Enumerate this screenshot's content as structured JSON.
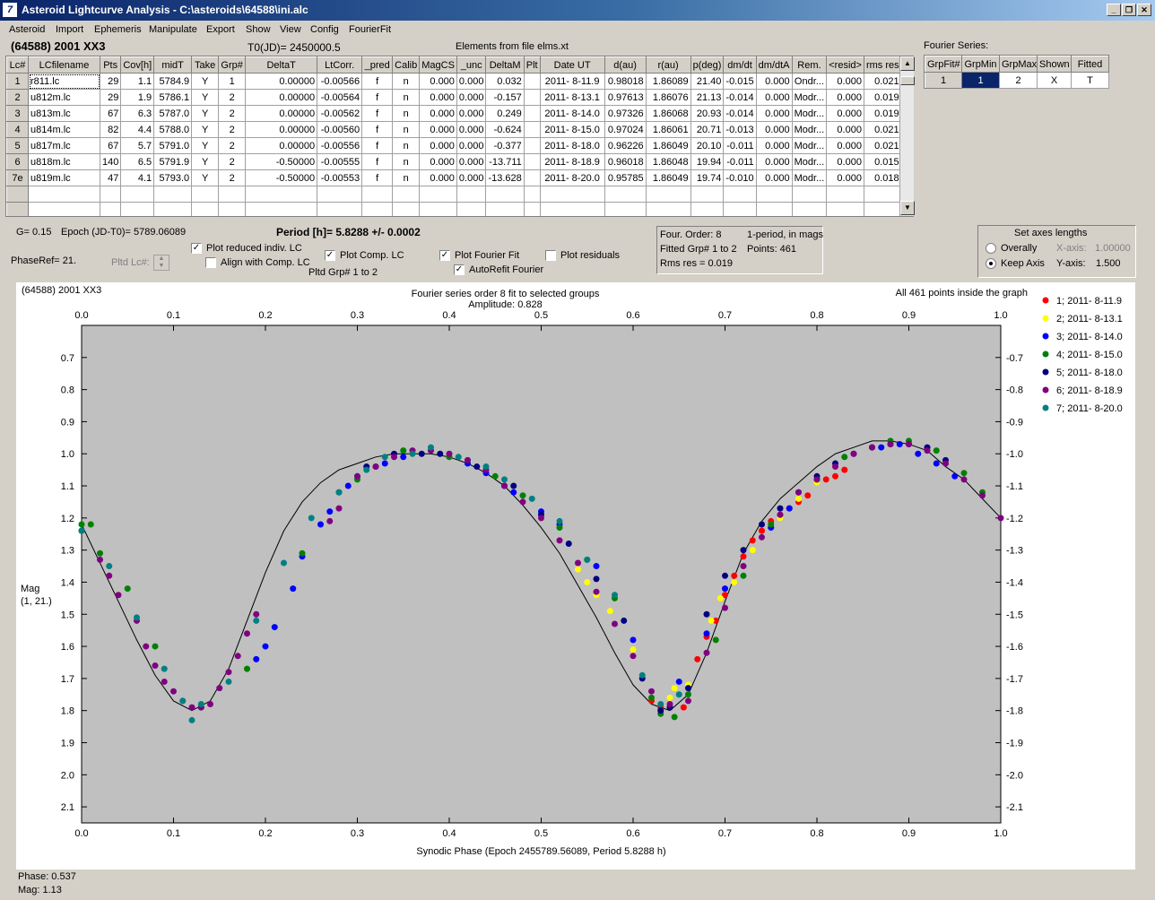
{
  "window": {
    "title": "Asteroid Lightcurve Analysis - C:\\asteroids\\64588\\ini.alc",
    "icon_glyph": "7",
    "minimize": "_",
    "restore": "❐",
    "close": "✕"
  },
  "menu": [
    "Asteroid",
    "Import",
    "Ephemeris",
    "Manipulate",
    "Export",
    "Show",
    "View",
    "Config",
    "FourierFit"
  ],
  "header": {
    "object": "(64588) 2001 XX3",
    "t0": "T0(JD)= 2450000.5",
    "elements": "Elements from file elms.xt"
  },
  "lc_table": {
    "columns": [
      "Lc#",
      "LCfilename",
      "Pts",
      "Cov[h]",
      "midT",
      "Take",
      "Grp#",
      "DeltaT",
      "LtCorr.",
      "_pred",
      "Calib",
      "MagCS",
      "_unc",
      "DeltaM",
      "Plt",
      "Date UT",
      "d(au)",
      "r(au)",
      "p(deg)",
      "dm/dt",
      "dm/dtA",
      "Rem.",
      "<resid>",
      "rms res"
    ],
    "rows": [
      [
        "1",
        "r811.lc",
        "29",
        "1.1",
        "5784.9",
        "Y",
        "1",
        "0.00000",
        "-0.00566",
        "f",
        "n",
        "0.000",
        "0.000",
        "0.032",
        "",
        "2011- 8-11.9",
        "0.98018",
        "1.86089",
        "21.40",
        "-0.015",
        "0.000",
        "Ondr...",
        "0.000",
        "0.021"
      ],
      [
        "2",
        "u812m.lc",
        "29",
        "1.9",
        "5786.1",
        "Y",
        "2",
        "0.00000",
        "-0.00564",
        "f",
        "n",
        "0.000",
        "0.000",
        "-0.157",
        "",
        "2011- 8-13.1",
        "0.97613",
        "1.86076",
        "21.13",
        "-0.014",
        "0.000",
        "Modr...",
        "0.000",
        "0.019"
      ],
      [
        "3",
        "u813m.lc",
        "67",
        "6.3",
        "5787.0",
        "Y",
        "2",
        "0.00000",
        "-0.00562",
        "f",
        "n",
        "0.000",
        "0.000",
        "0.249",
        "",
        "2011- 8-14.0",
        "0.97326",
        "1.86068",
        "20.93",
        "-0.014",
        "0.000",
        "Modr...",
        "0.000",
        "0.019"
      ],
      [
        "4",
        "u814m.lc",
        "82",
        "4.4",
        "5788.0",
        "Y",
        "2",
        "0.00000",
        "-0.00560",
        "f",
        "n",
        "0.000",
        "0.000",
        "-0.624",
        "",
        "2011- 8-15.0",
        "0.97024",
        "1.86061",
        "20.71",
        "-0.013",
        "0.000",
        "Modr...",
        "0.000",
        "0.021"
      ],
      [
        "5",
        "u817m.lc",
        "67",
        "5.7",
        "5791.0",
        "Y",
        "2",
        "0.00000",
        "-0.00556",
        "f",
        "n",
        "0.000",
        "0.000",
        "-0.377",
        "",
        "2011- 8-18.0",
        "0.96226",
        "1.86049",
        "20.10",
        "-0.011",
        "0.000",
        "Modr...",
        "0.000",
        "0.021"
      ],
      [
        "6",
        "u818m.lc",
        "140",
        "6.5",
        "5791.9",
        "Y",
        "2",
        "-0.50000",
        "-0.00555",
        "f",
        "n",
        "0.000",
        "0.000",
        "-13.711",
        "",
        "2011- 8-18.9",
        "0.96018",
        "1.86048",
        "19.94",
        "-0.011",
        "0.000",
        "Modr...",
        "0.000",
        "0.015"
      ],
      [
        "7e",
        "u819m.lc",
        "47",
        "4.1",
        "5793.0",
        "Y",
        "2",
        "-0.50000",
        "-0.00553",
        "f",
        "n",
        "0.000",
        "0.000",
        "-13.628",
        "",
        "2011- 8-20.0",
        "0.95785",
        "1.86049",
        "19.74",
        "-0.010",
        "0.000",
        "Modr...",
        "0.000",
        "0.018"
      ]
    ]
  },
  "fourier_series": {
    "label": "Fourier Series:",
    "columns": [
      "GrpFit#",
      "GrpMin",
      "GrpMax",
      "Shown",
      "Fitted"
    ],
    "row": [
      "1",
      "1",
      "2",
      "X",
      "T"
    ]
  },
  "params": {
    "g": "G= 0.15",
    "epoch": "Epoch (JD-T0)= 5789.06089",
    "period": "Period [h]= 5.8288 +/- 0.0002",
    "phaseref": "PhaseRef= 21.",
    "pltd_lc": "Pltd Lc#:"
  },
  "options": {
    "plot_reduced": "Plot reduced indiv. LC",
    "align_comp": "Align with Comp. LC",
    "plot_comp": "Plot Comp. LC",
    "pltd_grp": "Pltd Grp#  1   to   2",
    "plot_fourier": "Plot Fourier Fit",
    "autorefit": "AutoRefit Fourier",
    "plot_resid": "Plot residuals"
  },
  "checkbox_mark": "✓",
  "info": {
    "order": "Four. Order:  8",
    "period_mode": "1-period, in mags",
    "fitted": "Fitted Grp# 1 to 2",
    "points": "Points: 461",
    "rms": "Rms res     = 0.019"
  },
  "axes": {
    "title": "Set axes lengths",
    "overally": "Overally",
    "keep": "Keep Axis",
    "xaxis_label": "X-axis:",
    "xaxis_val": "1.00000",
    "yaxis_label": "Y-axis:",
    "yaxis_val": "1.500"
  },
  "status": {
    "phase": "Phase:  0.537",
    "mag": "Mag:   1.13"
  },
  "chart_data": {
    "type": "scatter",
    "title_left": "(64588) 2001 XX3",
    "title_center": "Fourier series order 8 fit to selected groups",
    "subtitle": "Amplitude: 0.828",
    "title_right": "All 461 points inside the graph",
    "xlabel": "Synodic Phase (Epoch 2455789.56089, Period 5.8288 h)",
    "ylabel": "Mag\n(1, 21.)",
    "xlim": [
      0.0,
      1.0
    ],
    "ylim": [
      0.6,
      2.15
    ],
    "x_ticks": [
      "0.0",
      "0.1",
      "0.2",
      "0.3",
      "0.4",
      "0.5",
      "0.6",
      "0.7",
      "0.8",
      "0.9",
      "1.0"
    ],
    "y_ticks": [
      "0.7",
      "0.8",
      "0.9",
      "1.0",
      "1.1",
      "1.2",
      "1.3",
      "1.4",
      "1.5",
      "1.6",
      "1.7",
      "1.8",
      "1.9",
      "2.0",
      "2.1"
    ],
    "grid": false,
    "background": "#c0c0c0",
    "legend_position": "right",
    "fit_curve": {
      "x": [
        0.0,
        0.02,
        0.04,
        0.06,
        0.08,
        0.1,
        0.12,
        0.14,
        0.16,
        0.18,
        0.2,
        0.22,
        0.24,
        0.26,
        0.28,
        0.3,
        0.32,
        0.34,
        0.36,
        0.38,
        0.4,
        0.42,
        0.44,
        0.46,
        0.48,
        0.5,
        0.52,
        0.54,
        0.56,
        0.58,
        0.6,
        0.62,
        0.64,
        0.66,
        0.68,
        0.7,
        0.72,
        0.74,
        0.76,
        0.78,
        0.8,
        0.82,
        0.84,
        0.86,
        0.88,
        0.9,
        0.92,
        0.94,
        0.96,
        0.98,
        1.0
      ],
      "y": [
        1.22,
        1.34,
        1.46,
        1.58,
        1.69,
        1.77,
        1.8,
        1.77,
        1.67,
        1.52,
        1.37,
        1.24,
        1.15,
        1.09,
        1.05,
        1.03,
        1.01,
        1.0,
        1.0,
        1.0,
        1.01,
        1.03,
        1.06,
        1.1,
        1.16,
        1.23,
        1.31,
        1.41,
        1.51,
        1.62,
        1.72,
        1.78,
        1.8,
        1.75,
        1.62,
        1.46,
        1.31,
        1.21,
        1.14,
        1.09,
        1.04,
        1.0,
        0.98,
        0.96,
        0.96,
        0.97,
        0.99,
        1.04,
        1.08,
        1.14,
        1.2
      ]
    },
    "series": [
      {
        "name": "1; 2011- 8-11.9",
        "color": "#ff0000",
        "x": [
          0.62,
          0.63,
          0.64,
          0.655,
          0.67,
          0.68,
          0.69,
          0.7,
          0.71,
          0.72,
          0.73,
          0.74,
          0.75,
          0.76,
          0.77,
          0.78,
          0.79,
          0.8,
          0.81,
          0.82,
          0.83
        ],
        "y": [
          1.77,
          1.79,
          1.79,
          1.79,
          1.64,
          1.57,
          1.52,
          1.44,
          1.38,
          1.32,
          1.27,
          1.24,
          1.21,
          1.19,
          1.17,
          1.15,
          1.13,
          1.09,
          1.08,
          1.07,
          1.05
        ]
      },
      {
        "name": "2; 2011- 8-13.1",
        "color": "#ffff00",
        "x": [
          0.54,
          0.55,
          0.56,
          0.575,
          0.6,
          0.64,
          0.645,
          0.66,
          0.685,
          0.695,
          0.71,
          0.73,
          0.76,
          0.78,
          0.8,
          0.82
        ],
        "y": [
          1.36,
          1.4,
          1.44,
          1.49,
          1.61,
          1.76,
          1.73,
          1.72,
          1.52,
          1.45,
          1.4,
          1.3,
          1.2,
          1.14,
          1.09,
          1.04
        ]
      },
      {
        "name": "3; 2011- 8-14.0",
        "color": "#0000ff",
        "x": [
          0.19,
          0.2,
          0.21,
          0.23,
          0.24,
          0.26,
          0.27,
          0.29,
          0.3,
          0.32,
          0.33,
          0.35,
          0.42,
          0.44,
          0.46,
          0.47,
          0.5,
          0.52,
          0.56,
          0.6,
          0.65,
          0.68,
          0.7,
          0.75,
          0.77,
          0.87,
          0.89,
          0.91,
          0.93,
          0.95
        ],
        "y": [
          1.64,
          1.6,
          1.54,
          1.42,
          1.32,
          1.22,
          1.18,
          1.1,
          1.07,
          1.04,
          1.03,
          1.01,
          1.03,
          1.06,
          1.1,
          1.12,
          1.18,
          1.22,
          1.35,
          1.58,
          1.71,
          1.56,
          1.42,
          1.23,
          1.17,
          0.98,
          0.97,
          1.0,
          1.03,
          1.07
        ]
      },
      {
        "name": "4; 2011- 8-15.0",
        "color": "#008000",
        "x": [
          0.0,
          0.01,
          0.02,
          0.05,
          0.08,
          0.13,
          0.18,
          0.24,
          0.3,
          0.35,
          0.4,
          0.42,
          0.45,
          0.48,
          0.52,
          0.55,
          0.58,
          0.62,
          0.63,
          0.645,
          0.66,
          0.69,
          0.72,
          0.75,
          0.8,
          0.83,
          0.86,
          0.88,
          0.9,
          0.93,
          0.96,
          0.98
        ],
        "y": [
          1.22,
          1.22,
          1.31,
          1.42,
          1.6,
          1.79,
          1.67,
          1.31,
          1.08,
          0.99,
          1.01,
          1.02,
          1.07,
          1.13,
          1.23,
          1.33,
          1.45,
          1.76,
          1.81,
          1.82,
          1.75,
          1.58,
          1.38,
          1.22,
          1.08,
          1.01,
          0.98,
          0.96,
          0.96,
          0.99,
          1.06,
          1.12
        ]
      },
      {
        "name": "5; 2011- 8-18.0",
        "color": "#000080",
        "x": [
          0.28,
          0.31,
          0.34,
          0.37,
          0.39,
          0.43,
          0.47,
          0.5,
          0.53,
          0.56,
          0.59,
          0.61,
          0.63,
          0.64,
          0.66,
          0.68,
          0.7,
          0.72,
          0.74,
          0.76,
          0.78,
          0.8,
          0.82,
          0.84,
          0.86,
          0.88,
          0.9,
          0.92,
          0.94
        ],
        "y": [
          1.12,
          1.04,
          1.0,
          1.0,
          1.0,
          1.04,
          1.1,
          1.19,
          1.28,
          1.39,
          1.52,
          1.7,
          1.8,
          1.79,
          1.73,
          1.5,
          1.38,
          1.3,
          1.22,
          1.17,
          1.12,
          1.07,
          1.03,
          1.0,
          0.98,
          0.97,
          0.97,
          0.98,
          1.02
        ]
      },
      {
        "name": "6; 2011- 8-18.9",
        "color": "#800080",
        "x": [
          0.0,
          0.02,
          0.03,
          0.04,
          0.06,
          0.07,
          0.08,
          0.09,
          0.1,
          0.11,
          0.12,
          0.13,
          0.14,
          0.15,
          0.16,
          0.17,
          0.18,
          0.19,
          0.27,
          0.28,
          0.3,
          0.32,
          0.34,
          0.36,
          0.38,
          0.4,
          0.42,
          0.44,
          0.46,
          0.48,
          0.5,
          0.52,
          0.54,
          0.56,
          0.58,
          0.6,
          0.62,
          0.64,
          0.66,
          0.68,
          0.7,
          0.72,
          0.74,
          0.76,
          0.78,
          0.8,
          0.82,
          0.84,
          0.86,
          0.88,
          0.9,
          0.92,
          0.94,
          0.96,
          0.98,
          1.0
        ],
        "y": [
          1.24,
          1.33,
          1.38,
          1.44,
          1.52,
          1.6,
          1.66,
          1.71,
          1.74,
          1.77,
          1.79,
          1.79,
          1.78,
          1.73,
          1.68,
          1.63,
          1.56,
          1.5,
          1.21,
          1.17,
          1.07,
          1.04,
          1.01,
          0.99,
          0.99,
          1.0,
          1.02,
          1.05,
          1.1,
          1.15,
          1.2,
          1.27,
          1.34,
          1.43,
          1.53,
          1.63,
          1.74,
          1.78,
          1.77,
          1.62,
          1.48,
          1.35,
          1.26,
          1.19,
          1.12,
          1.08,
          1.04,
          1.0,
          0.98,
          0.97,
          0.97,
          0.99,
          1.03,
          1.08,
          1.13,
          1.2
        ]
      },
      {
        "name": "7; 2011- 8-20.0",
        "color": "#008080",
        "x": [
          0.0,
          0.03,
          0.06,
          0.09,
          0.11,
          0.12,
          0.13,
          0.16,
          0.19,
          0.22,
          0.25,
          0.28,
          0.31,
          0.33,
          0.36,
          0.38,
          0.41,
          0.44,
          0.46,
          0.49,
          0.52,
          0.55,
          0.58,
          0.61,
          0.63,
          0.65
        ],
        "y": [
          1.24,
          1.35,
          1.51,
          1.67,
          1.77,
          1.83,
          1.78,
          1.71,
          1.52,
          1.34,
          1.2,
          1.12,
          1.05,
          1.01,
          1.0,
          0.98,
          1.01,
          1.04,
          1.08,
          1.14,
          1.21,
          1.33,
          1.44,
          1.69,
          1.78,
          1.75
        ]
      }
    ]
  }
}
